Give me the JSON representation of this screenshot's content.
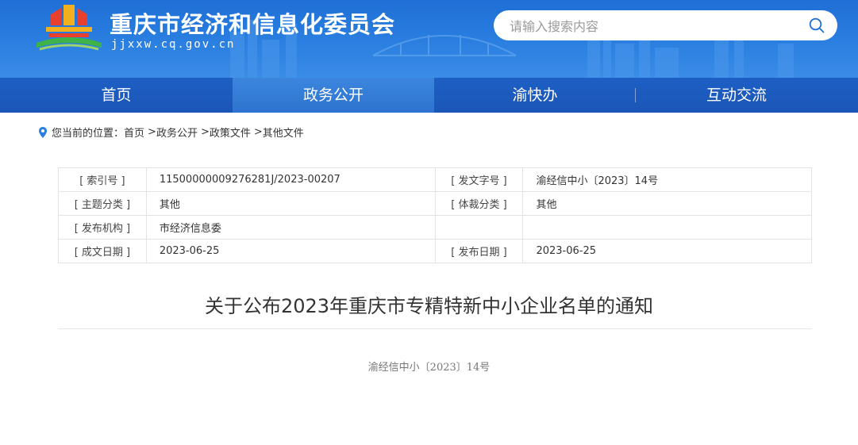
{
  "header": {
    "site_title": "重庆市经济和信息化委员会",
    "site_domain": "jjxxw.cq.gov.cn",
    "search_placeholder": "请输入搜索内容"
  },
  "nav": {
    "items": [
      {
        "label": "首页"
      },
      {
        "label": "政务公开",
        "active": true
      },
      {
        "label": "渝快办"
      },
      {
        "label": "互动交流"
      }
    ]
  },
  "breadcrumb": {
    "prefix": "您当前的位置：",
    "items": [
      "首页",
      "政务公开",
      "政策文件",
      "其他文件"
    ],
    "separator": ">"
  },
  "info_table": {
    "rows": [
      {
        "label1": "[ 索引号 ]",
        "value1": "11500000009276281J/2023-00207",
        "label2": "[ 发文字号 ]",
        "value2": "渝经信中小〔2023〕14号"
      },
      {
        "label1": "[ 主题分类 ]",
        "value1": "其他",
        "label2": "[ 体裁分类 ]",
        "value2": "其他"
      },
      {
        "label1": "[ 发布机构 ]",
        "value1": "市经济信息委",
        "label2": "",
        "value2": ""
      },
      {
        "label1": "[ 成文日期 ]",
        "value1": "2023-06-25",
        "label2": "[ 发布日期 ]",
        "value2": "2023-06-25"
      }
    ]
  },
  "document": {
    "title": "关于公布2023年重庆市专精特新中小企业名单的通知",
    "number": "渝经信中小〔2023〕14号"
  },
  "colors": {
    "header_blue": "#2a7fe0",
    "nav_blue": "#1a56b6",
    "nav_active": "#3c86de",
    "pin": "#2a7fe0"
  }
}
